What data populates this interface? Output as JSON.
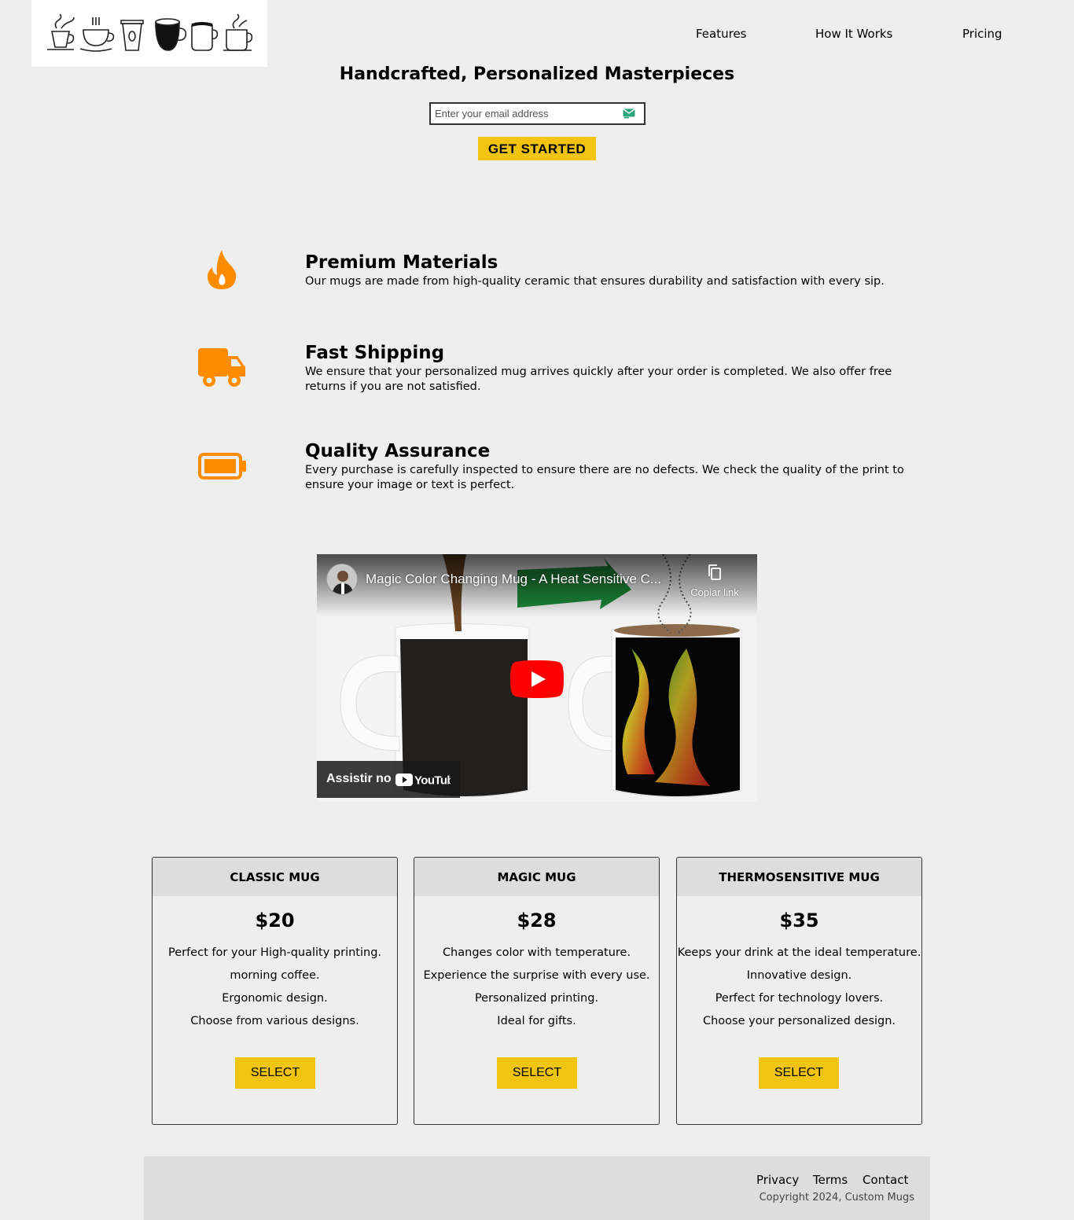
{
  "nav": {
    "features": "Features",
    "how_it_works": "How It Works",
    "pricing": "Pricing"
  },
  "hero": {
    "headline": "Handcrafted, Personalized Masterpieces",
    "email_placeholder": "Enter your email address",
    "cta_label": "GET STARTED"
  },
  "features": [
    {
      "icon": "fire-icon",
      "title": "Premium Materials",
      "text": "Our mugs are made from high-quality ceramic that ensures durability and satisfaction with every sip."
    },
    {
      "icon": "truck-icon",
      "title": "Fast Shipping",
      "text": "We ensure that your personalized mug arrives quickly after your order is completed. We also offer free returns if you are not satisfied."
    },
    {
      "icon": "battery-icon",
      "title": "Quality Assurance",
      "text": "Every purchase is carefully inspected to ensure there are no defects. We check the quality of the print to ensure your image or text is perfect."
    }
  ],
  "video": {
    "title": "Magic Color Changing Mug - A Heat Sensitive C...",
    "copy_link": "Copiar link",
    "watch_on": "Assistir no",
    "brand": "YouTube"
  },
  "pricing": [
    {
      "name": "CLASSIC MUG",
      "price": "$20",
      "features": [
        "Perfect for your High-quality printing.",
        "morning coffee.",
        "Ergonomic design.",
        "Choose from various designs."
      ],
      "button": "SELECT"
    },
    {
      "name": "MAGIC MUG",
      "price": "$28",
      "features": [
        "Changes color with temperature.",
        "Experience the surprise with every use.",
        "Personalized printing.",
        "Ideal for gifts."
      ],
      "button": "SELECT"
    },
    {
      "name": "THERMOSENSITIVE MUG",
      "price": "$35",
      "features": [
        "Keeps your drink at the ideal temperature.",
        "Innovative design.",
        "Perfect for technology lovers.",
        "Choose your personalized design."
      ],
      "button": "SELECT"
    }
  ],
  "footer": {
    "privacy": "Privacy",
    "terms": "Terms",
    "contact": "Contact",
    "copyright": "Copyright 2024, Custom Mugs"
  },
  "colors": {
    "accent": "#f1c40f",
    "icon": "#ff8c00",
    "background": "#eeeeee",
    "panel": "#dddddd"
  }
}
